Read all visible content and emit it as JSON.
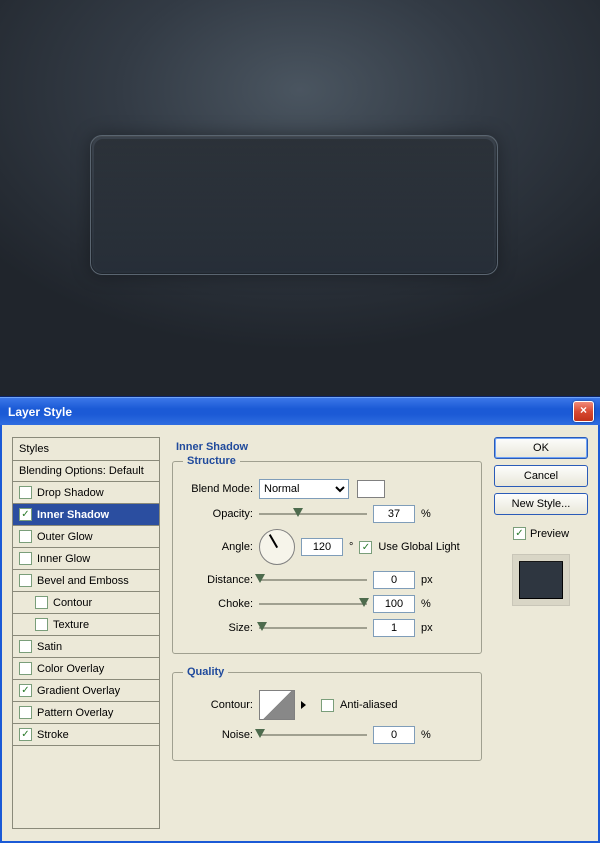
{
  "dialog": {
    "title": "Layer Style",
    "close_glyph": "×"
  },
  "styles_list": {
    "header": "Styles",
    "blending": "Blending Options: Default",
    "items": [
      {
        "label": "Drop Shadow",
        "checked": false,
        "selected": false
      },
      {
        "label": "Inner Shadow",
        "checked": true,
        "selected": true
      },
      {
        "label": "Outer Glow",
        "checked": false,
        "selected": false
      },
      {
        "label": "Inner Glow",
        "checked": false,
        "selected": false
      },
      {
        "label": "Bevel and Emboss",
        "checked": false,
        "selected": false
      },
      {
        "label": "Contour",
        "checked": false,
        "selected": false,
        "sub": true
      },
      {
        "label": "Texture",
        "checked": false,
        "selected": false,
        "sub": true
      },
      {
        "label": "Satin",
        "checked": false,
        "selected": false
      },
      {
        "label": "Color Overlay",
        "checked": false,
        "selected": false
      },
      {
        "label": "Gradient Overlay",
        "checked": true,
        "selected": false
      },
      {
        "label": "Pattern Overlay",
        "checked": false,
        "selected": false
      },
      {
        "label": "Stroke",
        "checked": true,
        "selected": false
      }
    ]
  },
  "inner_shadow": {
    "section_title": "Inner Shadow",
    "structure_legend": "Structure",
    "blend_mode_label": "Blend Mode:",
    "blend_mode_value": "Normal",
    "opacity_label": "Opacity:",
    "opacity_value": "37",
    "opacity_unit": "%",
    "angle_label": "Angle:",
    "angle_value": "120",
    "angle_deg": "°",
    "angle_rotate_deg": "-120",
    "use_global_label": "Use Global Light",
    "use_global_checked": true,
    "distance_label": "Distance:",
    "distance_value": "0",
    "distance_unit": "px",
    "choke_label": "Choke:",
    "choke_value": "100",
    "choke_unit": "%",
    "size_label": "Size:",
    "size_value": "1",
    "size_unit": "px",
    "quality_legend": "Quality",
    "contour_label": "Contour:",
    "anti_aliased_label": "Anti-aliased",
    "anti_aliased_checked": false,
    "noise_label": "Noise:",
    "noise_value": "0",
    "noise_unit": "%"
  },
  "buttons": {
    "ok": "OK",
    "cancel": "Cancel",
    "new_style": "New Style...",
    "preview_label": "Preview",
    "preview_checked": true
  }
}
